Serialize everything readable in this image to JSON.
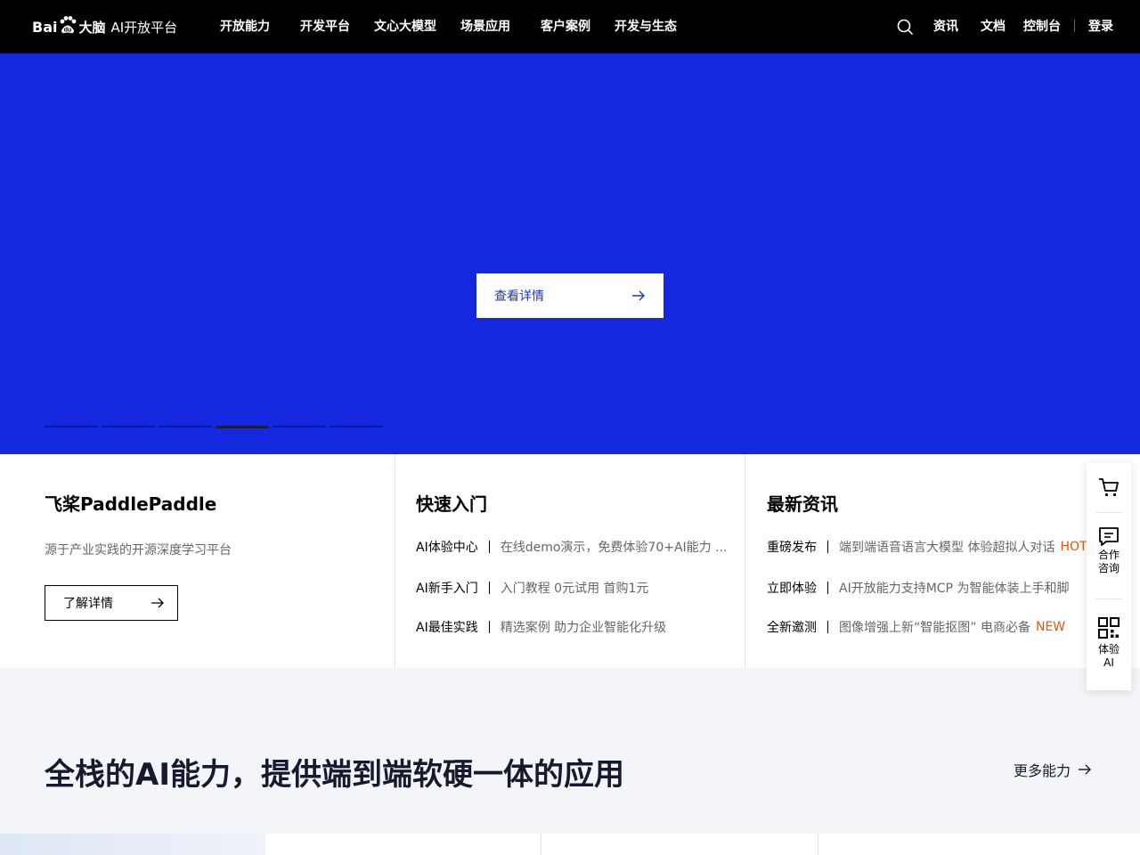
{
  "header": {
    "logo": {
      "bai": "Bai",
      "paw": "du",
      "brand": "大脑",
      "platform": "AI开放平台"
    },
    "nav": [
      {
        "label": "开放能力"
      },
      {
        "label": "开发平台"
      },
      {
        "label": "文心大模型"
      },
      {
        "label": "场景应用"
      },
      {
        "label": "客户案例"
      },
      {
        "label": "开发与生态"
      }
    ],
    "right": {
      "news": "资讯",
      "docs": "文档",
      "console": "控制台",
      "login": "登录"
    }
  },
  "hero": {
    "cta_label": "查看详情",
    "slides_total": 6,
    "active_slide": 4,
    "bg_color": "#1428e0"
  },
  "cards": {
    "paddle": {
      "title": "飞桨PaddlePaddle",
      "desc": "源于产业实践的开源深度学习平台",
      "button": "了解详情"
    },
    "quickstart": {
      "title": "快速入门",
      "rows": [
        {
          "label": "AI体验中心",
          "text": "在线demo演示，免费体验70+AI能力 ..."
        },
        {
          "label": "AI新手入门",
          "text": "入门教程 0元试用 首购1元"
        },
        {
          "label": "AI最佳实践",
          "text": "精选案例 助力企业智能化升级"
        }
      ]
    },
    "news": {
      "title": "最新资讯",
      "rows": [
        {
          "label": "重磅发布",
          "text": "端到端语音语言大模型 体验超拟人对话",
          "tag": "HOT"
        },
        {
          "label": "立即体验",
          "text": "AI开放能力支持MCP 为智能体装上手和脚",
          "tag": ""
        },
        {
          "label": "全新邀测",
          "text": "图像增强上新“智能抠图” 电商必备",
          "tag": "NEW"
        }
      ]
    }
  },
  "section": {
    "title": "全栈的AI能力，提供端到端软硬一体的应用",
    "more": "更多能力"
  },
  "sidebar": {
    "cart_icon": "cart-icon",
    "consult": "合作咨询",
    "trial": "体验AI"
  }
}
